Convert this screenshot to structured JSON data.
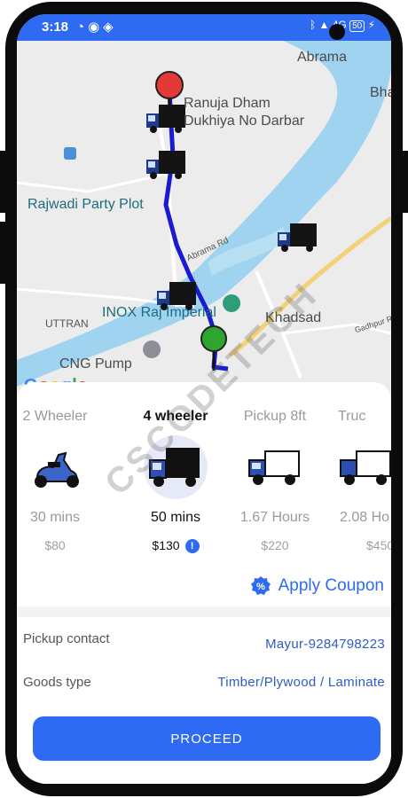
{
  "status_bar": {
    "time": "3:18",
    "left_icons": [
      "whatsapp-icon",
      "record-icon",
      "diamond-icon"
    ],
    "right_text": "⁎ ✕ 4G ▮ 50 ⚡",
    "battery": "50"
  },
  "map": {
    "labels": {
      "abrama": "Abrama",
      "bha": "Bha",
      "ranuja_line1": "Ranuja Dham",
      "ranuja_line2": "Dukhiya No Darbar",
      "rajwadi": "Rajwadi Party Plot",
      "abrama_rd": "Abrama Rd",
      "inox": "INOX Raj Imperial",
      "khadsad": "Khadsad",
      "uttran": "UTTRAN",
      "gadhpur_rd": "Gadhpur Rd",
      "cng": "CNG Pump",
      "google": "Google"
    },
    "route_color": "#1a1ad1",
    "start_pin_color": "#e53935",
    "end_pin_color": "#2ea52e"
  },
  "vehicles": [
    {
      "name": "2 Wheeler",
      "time": "30 mins",
      "price": "$80",
      "icon": "scooter-icon",
      "selected": false
    },
    {
      "name": "4 wheeler",
      "time": "50 mins",
      "price": "$130",
      "icon": "truck-icon",
      "selected": true
    },
    {
      "name": "Pickup 8ft",
      "time": "1.67 Hours",
      "price": "$220",
      "icon": "pickup-truck-icon",
      "selected": false
    },
    {
      "name": "Truc",
      "time": "2.08 Ho",
      "price": "$450",
      "icon": "large-truck-icon",
      "selected": false
    }
  ],
  "price_info_mark": "!",
  "coupon": {
    "label": "Apply Coupon",
    "icon_text": "%"
  },
  "pickup_contact": {
    "label": "Pickup contact",
    "value": "Mayur-9284798223"
  },
  "goods_type": {
    "label": "Goods type",
    "value": "Timber/Plywood / Laminate"
  },
  "proceed_label": "PROCEED",
  "watermark": "CSCODETECH",
  "colors": {
    "accent": "#2e6bf2",
    "status_bar": "#2e6bf2"
  }
}
